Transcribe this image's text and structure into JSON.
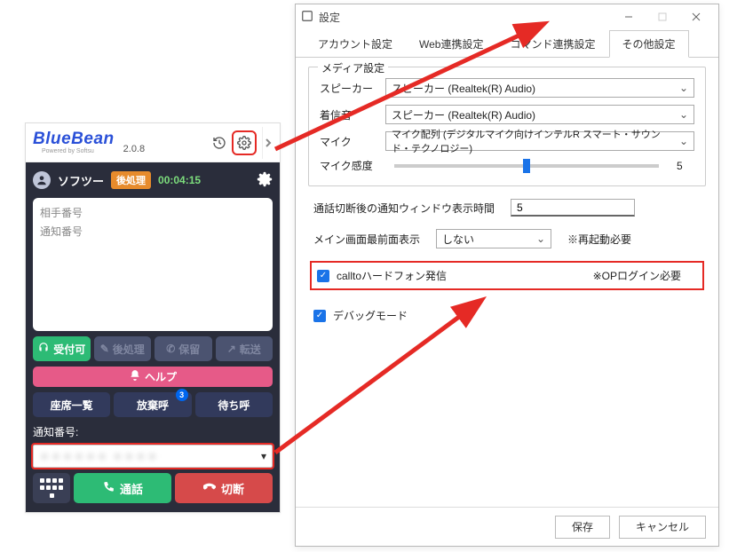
{
  "bluebean": {
    "logo": "BlueBean",
    "powered": "Powered by Softsu",
    "version": "2.0.8",
    "username": "ソフツー",
    "status": "後処理",
    "timer": "00:04:15",
    "memo": {
      "partner": "相手番号",
      "notify": "通知番号"
    },
    "buttons": {
      "accept": "受付可",
      "postproc": "後処理",
      "hold": "保留",
      "transfer": "転送",
      "help": "ヘルプ",
      "seatlist": "座席一覧",
      "abandon": "放棄呼",
      "waiting": "待ち呼",
      "abandon_badge": "3"
    },
    "notify_label": "通知番号:",
    "notify_value": "＊＊＊＊＊＊ ＊＊＊＊",
    "call_btn": "通話",
    "hangup_btn": "切断"
  },
  "settings": {
    "title": "設定",
    "tabs": {
      "account": "アカウント設定",
      "web": "Web連携設定",
      "command": "コマンド連携設定",
      "other": "その他設定"
    },
    "media": {
      "legend": "メディア設定",
      "speaker_label": "スピーカー",
      "speaker_value": "スピーカー (Realtek(R) Audio)",
      "ringer_label": "着信音",
      "ringer_value": "スピーカー (Realtek(R) Audio)",
      "mic_label": "マイク",
      "mic_value": "マイク配列 (デジタルマイク向けインテルR スマート・サウンド・テクノロジー)",
      "sens_label": "マイク感度",
      "sens_value": "5"
    },
    "post_disp_label": "通話切断後の通知ウィンドウ表示時間",
    "post_disp_value": "5",
    "foreground_label": "メイン画面最前面表示",
    "foreground_value": "しない",
    "foreground_note": "※再起動必要",
    "callto_label": "calltoハードフォン発信",
    "callto_note": "※OPログイン必要",
    "debug_label": "デバッグモード",
    "footer": {
      "save": "保存",
      "cancel": "キャンセル"
    }
  }
}
